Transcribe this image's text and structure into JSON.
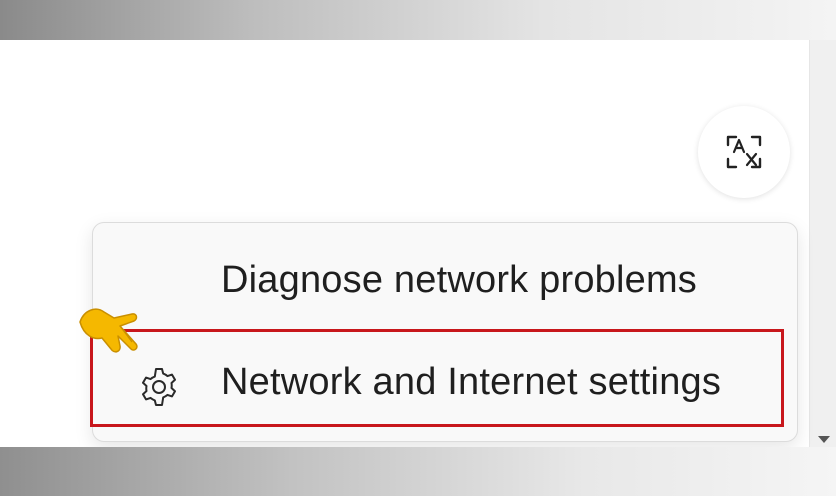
{
  "context_menu": {
    "items": [
      {
        "label": "Diagnose network problems",
        "icon": ""
      },
      {
        "label": "Network and Internet settings",
        "icon": "gear-icon",
        "highlighted": true
      }
    ]
  },
  "ime_button": {
    "icon": "character-recognition-icon"
  },
  "highlight_color": "#c8171c",
  "pointer": {
    "icon": "pointing-hand-icon",
    "color": "#f5b800"
  }
}
